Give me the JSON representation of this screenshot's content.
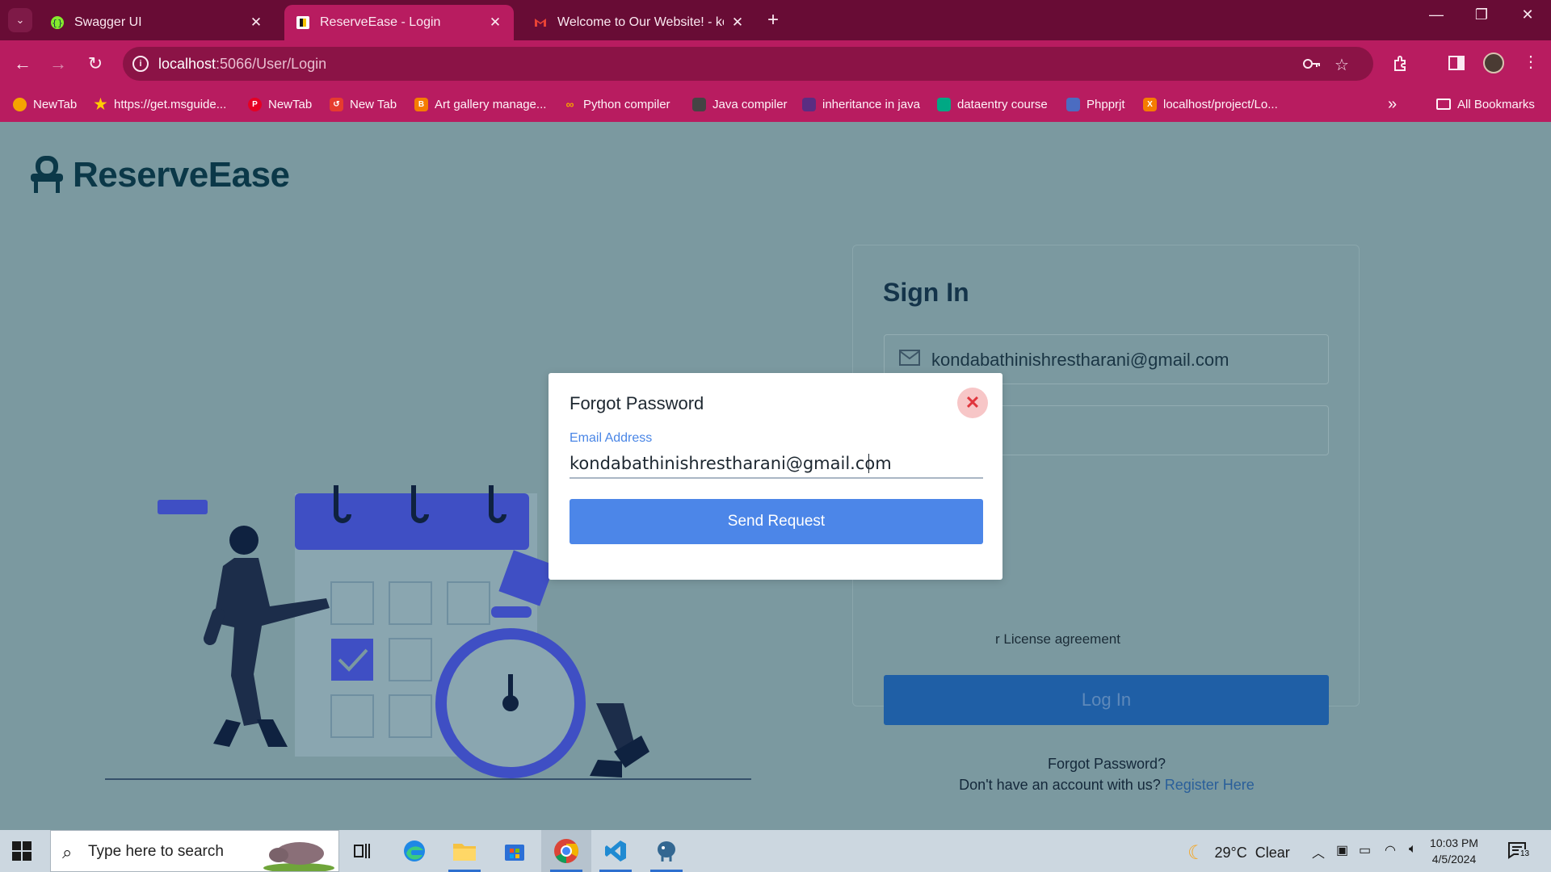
{
  "browser": {
    "tabs": [
      {
        "title": "Swagger UI",
        "icon": "swagger-icon",
        "color": "#85ea2d"
      },
      {
        "title": "ReserveEase - Login",
        "icon": "reserveease-favicon",
        "color": "#1f5fa6"
      },
      {
        "title": "Welcome to Our Website! - kon",
        "icon": "gmail-icon",
        "color": "#ea4335"
      }
    ],
    "url_host": "localhost",
    "url_path": ":5066/User/Login",
    "bookmarks": [
      {
        "label": "NewTab",
        "color": "#f5a400"
      },
      {
        "label": "https://get.msguide...",
        "color": "#ffcc00"
      },
      {
        "label": "NewTab",
        "color": "#e60023"
      },
      {
        "label": "New Tab",
        "color": "#e63c2f"
      },
      {
        "label": "Art gallery manage...",
        "color": "#f57d00"
      },
      {
        "label": "Python compiler",
        "color": "#f5a400"
      },
      {
        "label": "Java compiler",
        "color": "#444444"
      },
      {
        "label": "inheritance in java",
        "color": "#5a2d82"
      },
      {
        "label": "dataentry course",
        "color": "#00a884"
      },
      {
        "label": "Phpprjt",
        "color": "#4b6cc1"
      },
      {
        "label": "localhost/project/Lo...",
        "color": "#f57d00"
      }
    ],
    "all_bookmarks": "All Bookmarks",
    "more_bookmarks": "»"
  },
  "page": {
    "brand": "ReserveEase",
    "signin": {
      "title": "Sign In",
      "email_value": "kondabathinishrestharani@gmail.com",
      "license_text": "r License agreement",
      "login_button": "Log In",
      "forgot_link": "Forgot Password?",
      "register_prompt": "Don't have an account with us? ",
      "register_link": "Register Here"
    }
  },
  "modal": {
    "title": "Forgot Password",
    "close_label": "✕",
    "email_label": "Email Address",
    "email_value": "kondabathinishrestharani@gmail.com",
    "send_button": "Send Request"
  },
  "taskbar": {
    "search_placeholder": "Type here to search",
    "weather_temp": "29°C",
    "weather_desc": "Clear",
    "time": "10:03 PM",
    "date": "4/5/2024",
    "notifications": "13"
  }
}
